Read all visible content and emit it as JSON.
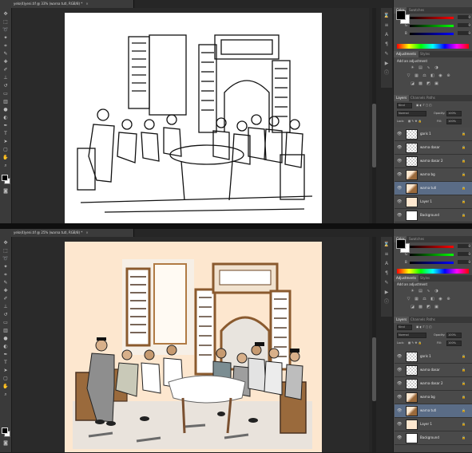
{
  "top": {
    "doc_tab": "yelo(4)yeni.tif @ 33% (warna tutl, RGB/8) *",
    "color_tabs": [
      "Color",
      "Swatches"
    ],
    "sliders": [
      {
        "label": "R",
        "value": "0"
      },
      {
        "label": "G",
        "value": "0"
      },
      {
        "label": "B",
        "value": "0"
      }
    ],
    "adjustments_tabs": [
      "Adjustments",
      "Styles"
    ],
    "adjustments_title": "Add an adjustment",
    "layers_tabs": [
      "Layers",
      "Channels",
      "Paths"
    ],
    "kind_label": "Kind",
    "blend_mode": "Normal",
    "opacity_label": "Opacity:",
    "opacity_value": "100%",
    "lock_label": "Lock:",
    "fill_label": "Fill:",
    "fill_value": "100%",
    "layers": [
      {
        "name": "garis 1",
        "thumb": "checker",
        "selected": false
      },
      {
        "name": "warna dasar",
        "thumb": "checker",
        "selected": false
      },
      {
        "name": "warna dasar 2",
        "thumb": "checker",
        "selected": false
      },
      {
        "name": "warna bg",
        "thumb": "art",
        "selected": false
      },
      {
        "name": "warna tutl",
        "thumb": "art",
        "selected": true
      },
      {
        "name": "Layer 1",
        "thumb": "peach",
        "selected": false
      },
      {
        "name": "Background",
        "thumb": "white",
        "selected": false
      }
    ]
  },
  "bottom": {
    "doc_tab": "yelo(4)yeni.tif @ 25% (warna tutl, RGB/8) *",
    "color_tabs": [
      "Color",
      "Swatches"
    ],
    "sliders": [
      {
        "label": "R",
        "value": "0"
      },
      {
        "label": "G",
        "value": "0"
      },
      {
        "label": "B",
        "value": "0"
      }
    ],
    "adjustments_tabs": [
      "Adjustments",
      "Styles"
    ],
    "adjustments_title": "Add an adjustment",
    "layers_tabs": [
      "Layers",
      "Channels",
      "Paths"
    ],
    "kind_label": "Kind",
    "blend_mode": "Normal",
    "opacity_label": "Opacity:",
    "opacity_value": "100%",
    "lock_label": "Lock:",
    "fill_label": "Fill:",
    "fill_value": "100%",
    "layers": [
      {
        "name": "garis 1",
        "thumb": "checker",
        "selected": false
      },
      {
        "name": "warna dasar",
        "thumb": "checker",
        "selected": false
      },
      {
        "name": "warna dasar 2",
        "thumb": "checker",
        "selected": false
      },
      {
        "name": "warna bg",
        "thumb": "art",
        "selected": false
      },
      {
        "name": "warna tutl",
        "thumb": "art",
        "selected": true
      },
      {
        "name": "Layer 1",
        "thumb": "peach",
        "selected": false
      },
      {
        "name": "Background",
        "thumb": "white",
        "selected": false
      }
    ]
  },
  "colors": {
    "canvas_top": "#ffffff",
    "canvas_bottom": "#fde7cf",
    "wood": "#9a6a3c",
    "suit_grey": "#8e8e8e",
    "panel_bg": "#484848",
    "selected_layer": "#5a6c86"
  },
  "icons": {
    "close": "close-icon",
    "eye": "eye-icon",
    "lock": "lock-icon"
  }
}
